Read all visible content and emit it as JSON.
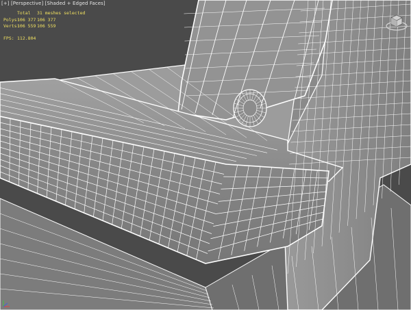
{
  "viewport": {
    "menu_plus": "[+]",
    "menu_view": "[Perspective]",
    "menu_shading": "[Shaded + Edged Faces]"
  },
  "stats": {
    "header_label": "Total",
    "header_value": "31 meshes selected",
    "rows": [
      {
        "label": "Polys:",
        "total": "106 377",
        "selected": "106 377"
      },
      {
        "label": "Verts:",
        "total": "106 559",
        "selected": "106 559"
      }
    ],
    "fps_label": "FPS:",
    "fps_value": "112.804"
  },
  "colors": {
    "background": "#464646",
    "mesh_surface": "#909090",
    "wire": "#ffffff",
    "stats_text": "#f0e060"
  },
  "icons": [
    "viewcube-icon",
    "axis-gizmo-icon"
  ]
}
